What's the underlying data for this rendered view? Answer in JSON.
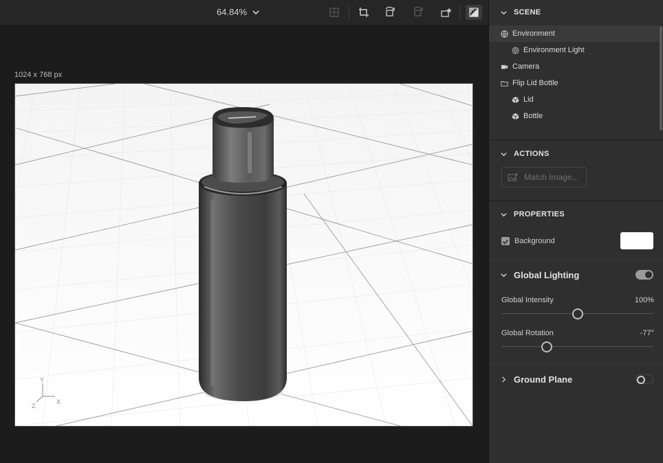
{
  "toolbar": {
    "zoom_label": "64.84%",
    "icons": [
      "frame-icon",
      "camera-crop-icon",
      "rotate-icon",
      "rotate-disabled-icon",
      "add-light-icon",
      "render-preview-icon"
    ]
  },
  "canvas": {
    "doc_size": "1024 x 768 px",
    "axis_labels": {
      "y": "Y",
      "x": "X",
      "z": "Z"
    }
  },
  "scene": {
    "title": "SCENE",
    "items": [
      {
        "label": "Environment",
        "icon": "globe-icon",
        "selected": true
      },
      {
        "label": "Environment Light",
        "icon": "globe-icon",
        "selected": false
      },
      {
        "label": "Camera",
        "icon": "camera-icon",
        "selected": false
      },
      {
        "label": "Flip Lid Bottle",
        "icon": "folder-icon",
        "selected": false
      },
      {
        "label": "Lid",
        "icon": "cube-icon",
        "selected": false
      },
      {
        "label": "Bottle",
        "icon": "cube-icon",
        "selected": false
      }
    ]
  },
  "actions": {
    "title": "ACTIONS",
    "match_image_label": "Match Image..."
  },
  "properties": {
    "title": "PROPERTIES",
    "background_label": "Background",
    "background_checked": true,
    "background_color": "#ffffff",
    "global_lighting": {
      "title": "Global Lighting",
      "enabled": true,
      "intensity_label": "Global Intensity",
      "intensity_value": "100%",
      "intensity_fraction": 0.5,
      "rotation_label": "Global Rotation",
      "rotation_value": "-77°",
      "rotation_fraction": 0.3
    },
    "ground_plane": {
      "title": "Ground Plane",
      "enabled": false
    }
  },
  "colors": {
    "panel_bg": "#2f2f2f",
    "canvas_bg": "#1c1c1c",
    "toggle_on": "#9a9a9a"
  }
}
